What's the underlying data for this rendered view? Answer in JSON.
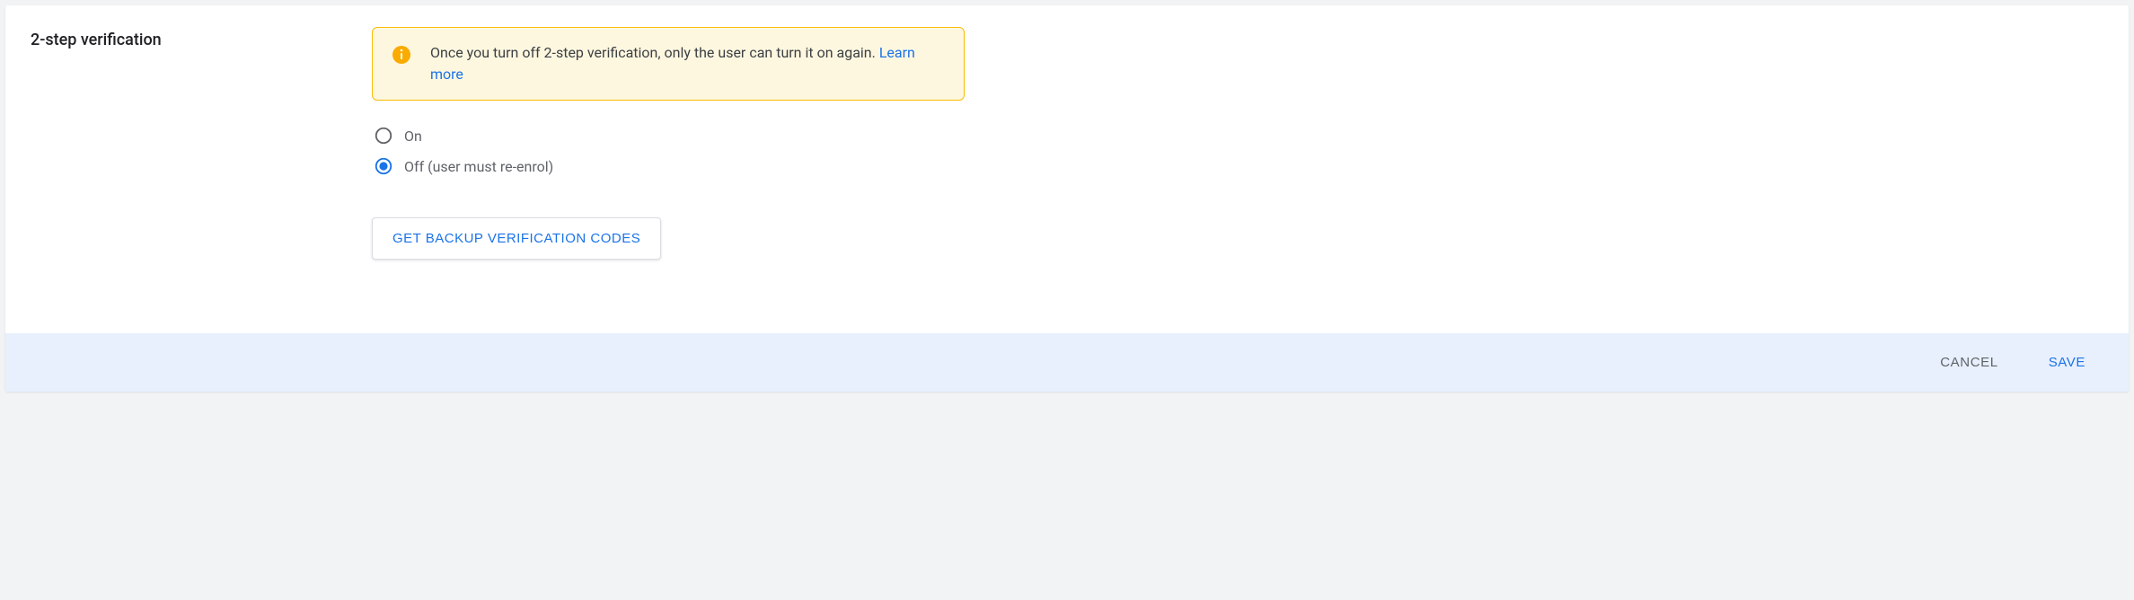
{
  "section": {
    "title": "2-step verification"
  },
  "alert": {
    "text": "Once you turn off 2-step verification, only the user can turn it on again. ",
    "link": "Learn more"
  },
  "radios": {
    "on": {
      "label": "On",
      "selected": false
    },
    "off": {
      "label": "Off (user must re-enrol)",
      "selected": true
    }
  },
  "buttons": {
    "backup": "GET BACKUP VERIFICATION CODES",
    "cancel": "CANCEL",
    "save": "SAVE"
  },
  "colors": {
    "accent": "#1a73e8",
    "warning_bg": "#fef7e0",
    "warning_border": "#fbbc04",
    "warning_icon": "#f9ab00",
    "footer_bg": "#e8f0fe"
  }
}
